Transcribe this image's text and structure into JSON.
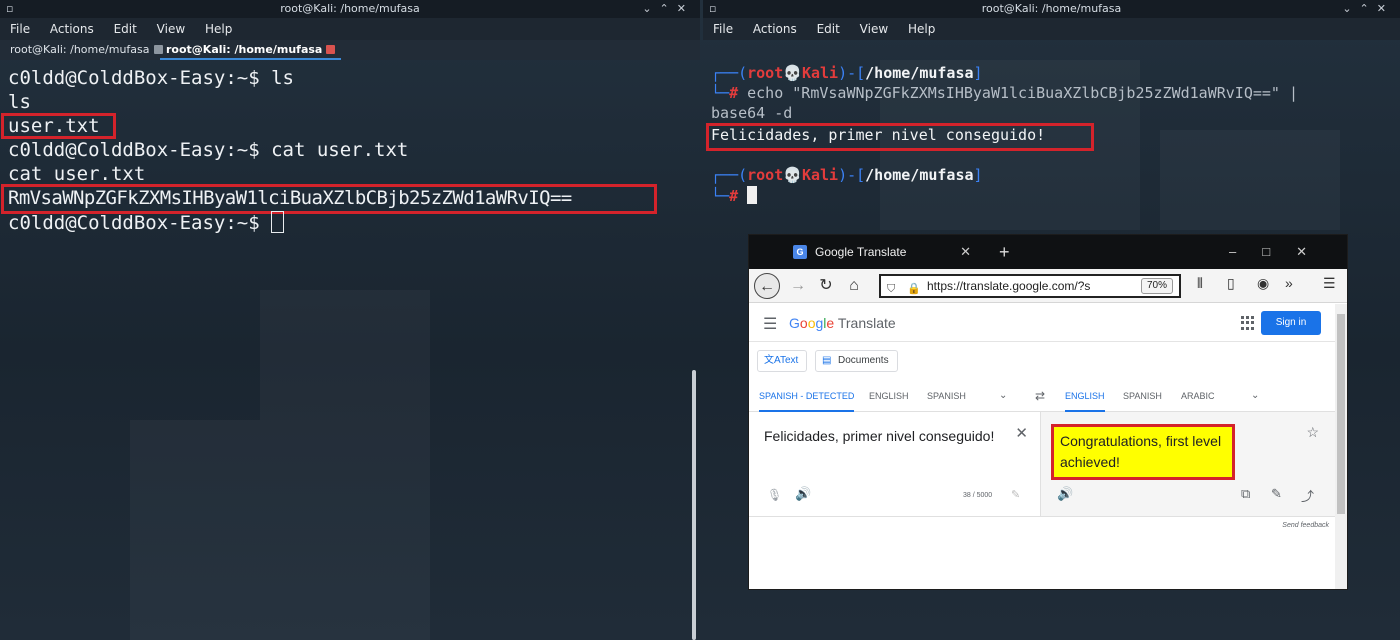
{
  "left_terminal": {
    "window_title": "root@Kali: /home/mufasa",
    "menu": [
      "File",
      "Actions",
      "Edit",
      "View",
      "Help"
    ],
    "tabs": [
      "root@Kali: /home/mufasa",
      "root@Kali: /home/mufasa"
    ],
    "active_tab": 1,
    "lines": [
      "c0ldd@ColddBox-Easy:~$ ls",
      "ls",
      "user.txt",
      "c0ldd@ColddBox-Easy:~$ cat user.txt",
      "cat user.txt",
      "RmVsaWNpZGFkZXMsIHByaW1lciBuaXZlbCBjb25zZWd1aWRvIQ==",
      "c0ldd@ColddBox-Easy:~$ "
    ],
    "highlighted_lines": [
      2,
      5
    ]
  },
  "right_terminal": {
    "window_title": "root@Kali: /home/mufasa",
    "menu": [
      "File",
      "Actions",
      "Edit",
      "View",
      "Help"
    ],
    "prompt": {
      "open": "┌──(",
      "user": "root",
      "skull": "💀",
      "host": "Kali",
      "mid": ")-[",
      "path": "/home/mufasa",
      "close": "]",
      "second_line": "└─",
      "symbol": "#"
    },
    "command_line1": " echo \"RmVsaWNpZGFkZXMsIHByaW1lciBuaXZlbCBjb25zZWd1aWRvIQ==\" |",
    "command_line2": "base64 -d",
    "output": "Felicidades, primer nivel conseguido!"
  },
  "browser": {
    "tab_title": "Google Translate",
    "url": "https://translate.google.com/?s",
    "zoom": "70%",
    "app": {
      "logo_word1": "Google",
      "logo_word2": " Translate",
      "sign_in": "Sign in",
      "mode_text": "Text",
      "mode_documents": "Documents",
      "source_langs": [
        "SPANISH - DETECTED",
        "ENGLISH",
        "SPANISH"
      ],
      "target_langs": [
        "ENGLISH",
        "SPANISH",
        "ARABIC"
      ],
      "source_text": "Felicidades, primer nivel conseguido!",
      "char_count": "38 / 5000",
      "translation": "Congratulations, first level achieved!",
      "send_feedback": "Send feedback"
    }
  },
  "colors": {
    "highlight_border": "#d4232b",
    "prompt_blue": "#3b82f6",
    "prompt_red": "#e23c3c",
    "google_blue": "#1a73e8",
    "translation_highlight": "#ffff00"
  }
}
